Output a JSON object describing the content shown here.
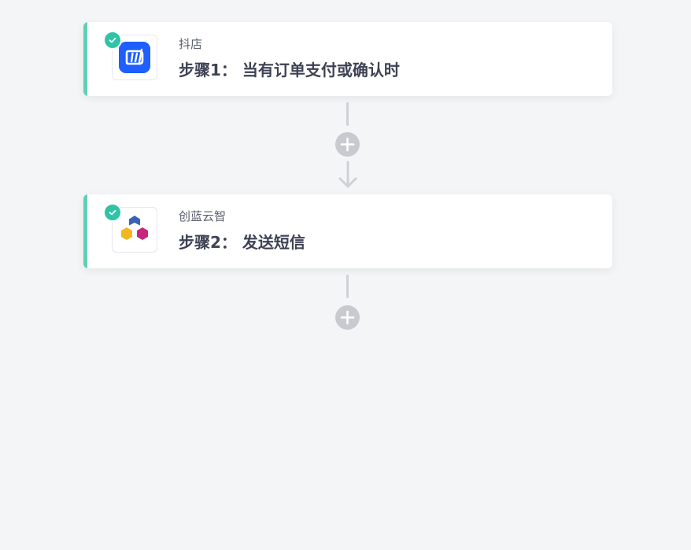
{
  "steps": [
    {
      "app_name": "抖店",
      "title": "步骤1： 当有订单支付或确认时",
      "logo_icon": "doudian-logo",
      "status": "check-circle-icon"
    },
    {
      "app_name": "创蓝云智",
      "title": "步骤2： 发送短信",
      "logo_icon": "chuanglan-logo",
      "status": "check-circle-icon"
    }
  ],
  "colors": {
    "background": "#f4f5f7",
    "accent": "#5fd0b5",
    "check": "#2ec4a5",
    "connector": "#cfd1d6",
    "title_text": "#3e4254"
  }
}
